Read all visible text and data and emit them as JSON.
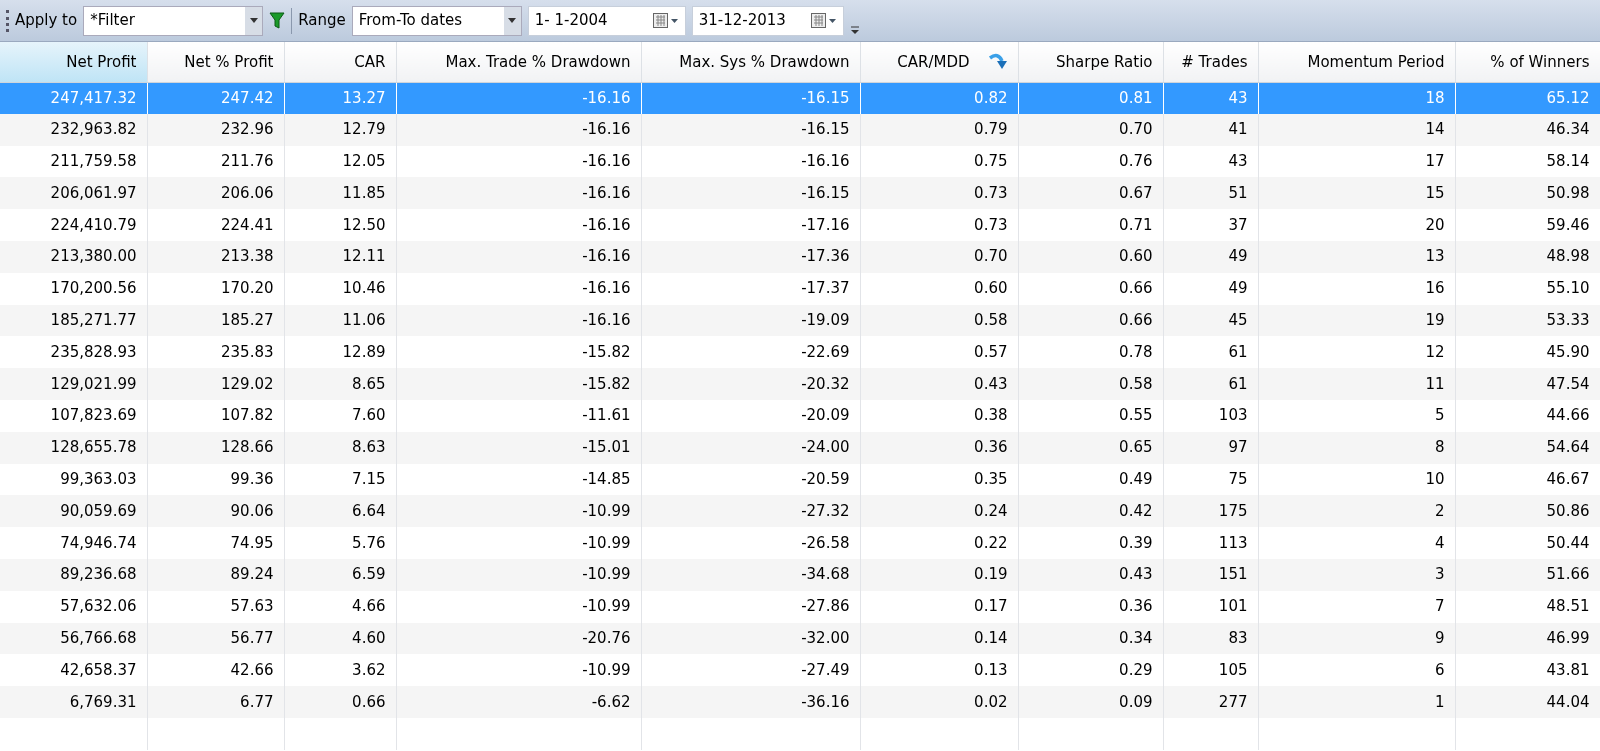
{
  "toolbar": {
    "apply_label": "Apply to",
    "apply_value": "*Filter",
    "range_label": "Range",
    "range_value": "From-To dates",
    "from_date": "1- 1-2004",
    "to_date": "31-12-2013"
  },
  "table": {
    "columns": [
      {
        "label": "Net Profit",
        "selected": true,
        "sorted": false
      },
      {
        "label": "Net % Profit",
        "selected": false,
        "sorted": false
      },
      {
        "label": "CAR",
        "selected": false,
        "sorted": false
      },
      {
        "label": "Max. Trade % Drawdown",
        "selected": false,
        "sorted": false
      },
      {
        "label": "Max. Sys % Drawdown",
        "selected": false,
        "sorted": false
      },
      {
        "label": "CAR/MDD",
        "selected": false,
        "sorted": true
      },
      {
        "label": "Sharpe Ratio",
        "selected": false,
        "sorted": false
      },
      {
        "label": "# Trades",
        "selected": false,
        "sorted": false
      },
      {
        "label": "Momentum Period",
        "selected": false,
        "sorted": false
      },
      {
        "label": "% of Winners",
        "selected": false,
        "sorted": false
      }
    ],
    "rows": [
      {
        "selected": true,
        "cells": [
          "247,417.32",
          "247.42",
          "13.27",
          "-16.16",
          "-16.15",
          "0.82",
          "0.81",
          "43",
          "18",
          "65.12"
        ]
      },
      {
        "selected": false,
        "cells": [
          "232,963.82",
          "232.96",
          "12.79",
          "-16.16",
          "-16.15",
          "0.79",
          "0.70",
          "41",
          "14",
          "46.34"
        ]
      },
      {
        "selected": false,
        "cells": [
          "211,759.58",
          "211.76",
          "12.05",
          "-16.16",
          "-16.16",
          "0.75",
          "0.76",
          "43",
          "17",
          "58.14"
        ]
      },
      {
        "selected": false,
        "cells": [
          "206,061.97",
          "206.06",
          "11.85",
          "-16.16",
          "-16.15",
          "0.73",
          "0.67",
          "51",
          "15",
          "50.98"
        ]
      },
      {
        "selected": false,
        "cells": [
          "224,410.79",
          "224.41",
          "12.50",
          "-16.16",
          "-17.16",
          "0.73",
          "0.71",
          "37",
          "20",
          "59.46"
        ]
      },
      {
        "selected": false,
        "cells": [
          "213,380.00",
          "213.38",
          "12.11",
          "-16.16",
          "-17.36",
          "0.70",
          "0.60",
          "49",
          "13",
          "48.98"
        ]
      },
      {
        "selected": false,
        "cells": [
          "170,200.56",
          "170.20",
          "10.46",
          "-16.16",
          "-17.37",
          "0.60",
          "0.66",
          "49",
          "16",
          "55.10"
        ]
      },
      {
        "selected": false,
        "cells": [
          "185,271.77",
          "185.27",
          "11.06",
          "-16.16",
          "-19.09",
          "0.58",
          "0.66",
          "45",
          "19",
          "53.33"
        ]
      },
      {
        "selected": false,
        "cells": [
          "235,828.93",
          "235.83",
          "12.89",
          "-15.82",
          "-22.69",
          "0.57",
          "0.78",
          "61",
          "12",
          "45.90"
        ]
      },
      {
        "selected": false,
        "cells": [
          "129,021.99",
          "129.02",
          "8.65",
          "-15.82",
          "-20.32",
          "0.43",
          "0.58",
          "61",
          "11",
          "47.54"
        ]
      },
      {
        "selected": false,
        "cells": [
          "107,823.69",
          "107.82",
          "7.60",
          "-11.61",
          "-20.09",
          "0.38",
          "0.55",
          "103",
          "5",
          "44.66"
        ]
      },
      {
        "selected": false,
        "cells": [
          "128,655.78",
          "128.66",
          "8.63",
          "-15.01",
          "-24.00",
          "0.36",
          "0.65",
          "97",
          "8",
          "54.64"
        ]
      },
      {
        "selected": false,
        "cells": [
          "99,363.03",
          "99.36",
          "7.15",
          "-14.85",
          "-20.59",
          "0.35",
          "0.49",
          "75",
          "10",
          "46.67"
        ]
      },
      {
        "selected": false,
        "cells": [
          "90,059.69",
          "90.06",
          "6.64",
          "-10.99",
          "-27.32",
          "0.24",
          "0.42",
          "175",
          "2",
          "50.86"
        ]
      },
      {
        "selected": false,
        "cells": [
          "74,946.74",
          "74.95",
          "5.76",
          "-10.99",
          "-26.58",
          "0.22",
          "0.39",
          "113",
          "4",
          "50.44"
        ]
      },
      {
        "selected": false,
        "cells": [
          "89,236.68",
          "89.24",
          "6.59",
          "-10.99",
          "-34.68",
          "0.19",
          "0.43",
          "151",
          "3",
          "51.66"
        ]
      },
      {
        "selected": false,
        "cells": [
          "57,632.06",
          "57.63",
          "4.66",
          "-10.99",
          "-27.86",
          "0.17",
          "0.36",
          "101",
          "7",
          "48.51"
        ]
      },
      {
        "selected": false,
        "cells": [
          "56,766.68",
          "56.77",
          "4.60",
          "-20.76",
          "-32.00",
          "0.14",
          "0.34",
          "83",
          "9",
          "46.99"
        ]
      },
      {
        "selected": false,
        "cells": [
          "42,658.37",
          "42.66",
          "3.62",
          "-10.99",
          "-27.49",
          "0.13",
          "0.29",
          "105",
          "6",
          "43.81"
        ]
      },
      {
        "selected": false,
        "cells": [
          "6,769.31",
          "6.77",
          "0.66",
          "-6.62",
          "-36.16",
          "0.02",
          "0.09",
          "277",
          "1",
          "44.04"
        ]
      }
    ]
  }
}
